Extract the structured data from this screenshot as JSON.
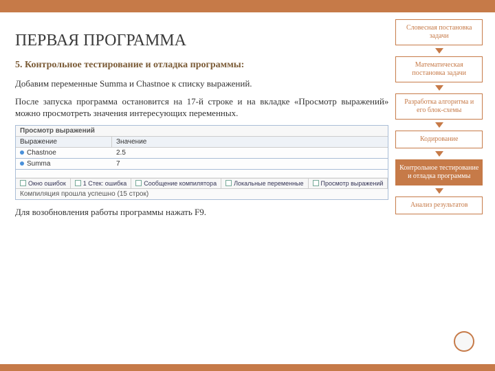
{
  "main": {
    "title": "ПЕРВАЯ ПРОГРАММА",
    "subtitle": "5. Контрольное тестирование и отладка программы:",
    "para1": "Добавим переменные Summa и Chastnoe к списку выражений.",
    "para2": "После запуска программа остановится на 17-й строке и на вкладке «Просмотр выражений» можно просмотреть значения интересующих переменных.",
    "resume": "Для возобновления работы программы нажать F9."
  },
  "ide": {
    "panel_title": "Просмотр выражений",
    "col1": "Выражение",
    "col2": "Значение",
    "rows": [
      {
        "name": "Chastnoe",
        "value": "2.5"
      },
      {
        "name": "Summa",
        "value": "7"
      }
    ],
    "tabs": [
      "Окно ошибок",
      "1  Стек: ошибка",
      "Сообщение компилятора",
      "Локальные переменные",
      "Просмотр выражений"
    ],
    "status": "Компиляция прошла успешно (15 строк)"
  },
  "side": {
    "steps": [
      "Словесная постановка задачи",
      "Математическая постановка задачи",
      "Разработка алгоритма и его блок-схемы",
      "Кодирование",
      "Контрольное тестирование и отладка программы",
      "Анализ результатов"
    ],
    "active_index": 4
  }
}
